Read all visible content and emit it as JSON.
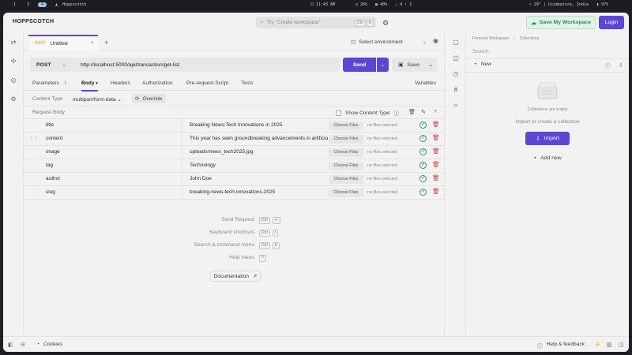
{
  "system_bar": {
    "workspaces": [
      "1",
      "3",
      "4"
    ],
    "active_app": "Hoppscotch",
    "clock": "11:43 AM",
    "cpu": "26%",
    "mem": "40%",
    "net_a": "4",
    "net_b": "1",
    "temp": "29°",
    "location": "Coimbatore, India",
    "battery": "97%"
  },
  "header": {
    "brand": "HOPPSCOTCH",
    "search_placeholder": "Try \"Create workspace\"",
    "search_key1": "Ctrl",
    "search_key2": "K",
    "save_workspace": "Save My Workspace",
    "login": "Login"
  },
  "request_tab": {
    "method": "POST",
    "title": "Untitled",
    "unsaved_dot": "•"
  },
  "environment": {
    "label": "Select environment"
  },
  "request": {
    "method": "POST",
    "url": "http://localhost:5000/api/transaction/get-list",
    "send": "Send",
    "save": "Save"
  },
  "subtabs": [
    {
      "label": "Parameters",
      "count": "1"
    },
    {
      "label": "Body",
      "count": ""
    },
    {
      "label": "Headers",
      "count": ""
    },
    {
      "label": "Authorization",
      "count": ""
    },
    {
      "label": "Pre-request Script",
      "count": ""
    },
    {
      "label": "Tests",
      "count": ""
    },
    {
      "label": "Variables",
      "count": ""
    }
  ],
  "body": {
    "content_type_label": "Content Type",
    "content_type_value": "multipart/form-data",
    "override": "Override",
    "request_body_label": "Request Body",
    "show_content_type": "Show Content Type",
    "choose_files": "Choose Files",
    "no_files": "no files selected",
    "rows": [
      {
        "key": "title",
        "value": "Breaking News:Tech Innovations in 2025"
      },
      {
        "key": "content",
        "value": "This year has seen groundbreaking advancements in artificial"
      },
      {
        "key": "image",
        "value": "uploads/news_tech2025.jpg"
      },
      {
        "key": "tag",
        "value": "Technology"
      },
      {
        "key": "author",
        "value": "John Doe"
      },
      {
        "key": "slug",
        "value": "breaking-news-tech-innovations-2025"
      }
    ]
  },
  "shortcuts": [
    {
      "label": "Send Request",
      "keys": [
        "Ctrl",
        "↵"
      ]
    },
    {
      "label": "Keyboard shortcuts",
      "keys": [
        "Ctrl",
        "/"
      ]
    },
    {
      "label": "Search & command menu",
      "keys": [
        "Ctrl",
        "K"
      ]
    },
    {
      "label": "Help menu",
      "keys": [
        "?"
      ]
    }
  ],
  "documentation": "Documentation",
  "collections": {
    "breadcrumb_root": "Personal Workspace",
    "breadcrumb_current": "Collections",
    "search_placeholder": "Search",
    "new": "New",
    "empty": "Collections are empty",
    "import_or_create": "Import or create a collection",
    "import": "Import",
    "add_new": "Add new"
  },
  "footer": {
    "cookies": "Cookies",
    "help_feedback": "Help & feedback"
  },
  "colors": {
    "accent": "#5b47d6",
    "success": "#2e9e5b",
    "danger": "#d83b3b",
    "save_ws_bg": "#e0f3e8"
  }
}
